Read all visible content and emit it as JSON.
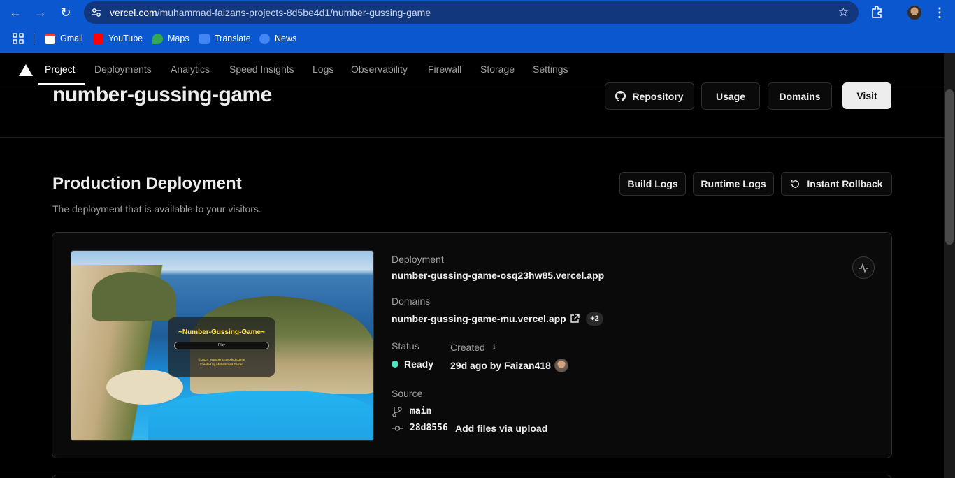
{
  "browser": {
    "url_host": "vercel.com",
    "url_path": "/muhammad-faizans-projects-8d5be4d1/number-gussing-game",
    "bookmarks": [
      {
        "label": "Gmail",
        "icon": "gmail-icon",
        "color": "#ea4335"
      },
      {
        "label": "YouTube",
        "icon": "youtube-icon",
        "color": "#ff0000"
      },
      {
        "label": "Maps",
        "icon": "maps-icon",
        "color": "#34a853"
      },
      {
        "label": "Translate",
        "icon": "translate-icon",
        "color": "#4285f4"
      },
      {
        "label": "News",
        "icon": "news-icon",
        "color": "#4285f4"
      }
    ]
  },
  "nav": {
    "tabs": [
      "Project",
      "Deployments",
      "Analytics",
      "Speed Insights",
      "Logs",
      "Observability",
      "Firewall",
      "Storage",
      "Settings"
    ],
    "active": "Project"
  },
  "project": {
    "title": "number-gussing-game",
    "buttons": {
      "repository": "Repository",
      "usage": "Usage",
      "domains": "Domains",
      "visit": "Visit"
    }
  },
  "production": {
    "title": "Production Deployment",
    "subtitle": "The deployment that is available to your visitors.",
    "buttons": {
      "build_logs": "Build Logs",
      "runtime_logs": "Runtime Logs",
      "rollback": "Instant Rollback"
    },
    "preview": {
      "game_title": "~Number-Gussing-Game~",
      "play": "Play",
      "footer_line1": "© 2024, Number Guessing Game",
      "footer_line2": "Created by Muhammad Faizan"
    },
    "deployment_label": "Deployment",
    "deployment_url": "number-gussing-game-osq23hw85.vercel.app",
    "domains_label": "Domains",
    "domain": "number-gussing-game-mu.vercel.app",
    "domain_extra": "+2",
    "status_label": "Status",
    "status": "Ready",
    "status_color": "#50e3c2",
    "created_label": "Created",
    "created": "29d ago by Faizan418",
    "source_label": "Source",
    "branch": "main",
    "commit_hash": "28d8556",
    "commit_msg": "Add files via upload"
  }
}
